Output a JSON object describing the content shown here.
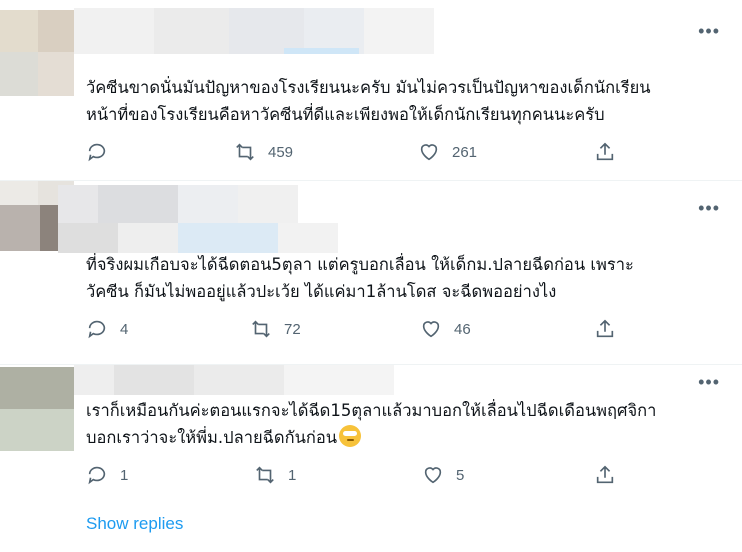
{
  "tweets": [
    {
      "lines": [
        "วัคซีนขาดนั่นมันปัญหาของโรงเรียนนะครับ มันไม่ควรเป็นปัญหาของเด็กนักเรียน",
        "หน้าที่ของโรงเรียนคือหาวัคซีนที่ดีและเพียงพอให้เด็กนักเรียนทุกคนนะครับ"
      ],
      "replies": "",
      "retweets": "459",
      "likes": "261"
    },
    {
      "lines": [
        "ที่จริงผมเกือบจะได้ฉีดตอน5ตุลา แต่ครูบอกเลื่อน ให้เด็กม.ปลายฉีดก่อน เพราะ",
        "วัคซีน ก็มันไม่พออยู่แล้วปะเว้ย ได้แค่มา1ล้านโดส จะฉีดพออย่างไง"
      ],
      "replies": "4",
      "retweets": "72",
      "likes": "46"
    },
    {
      "lines": [
        "เราก็เหมือนกันค่ะตอนแรกจะได้ฉีด15ตุลาแล้วมาบอกให้เลื่อนไปฉีดเดือนพฤศจิกา",
        "บอกเราว่าจะให้พี่ม.ปลายฉีดกันก่อน"
      ],
      "replies": "1",
      "retweets": "1",
      "likes": "5"
    }
  ],
  "more_label": "•••",
  "show_replies": "Show replies",
  "icons": {
    "reply": "reply-icon",
    "retweet": "retweet-icon",
    "like": "heart-icon",
    "share": "share-icon",
    "emoji": "rolling-eyes-emoji"
  },
  "colors": {
    "accent": "#1d9bf0",
    "muted": "#536471",
    "text": "#0f1419"
  }
}
